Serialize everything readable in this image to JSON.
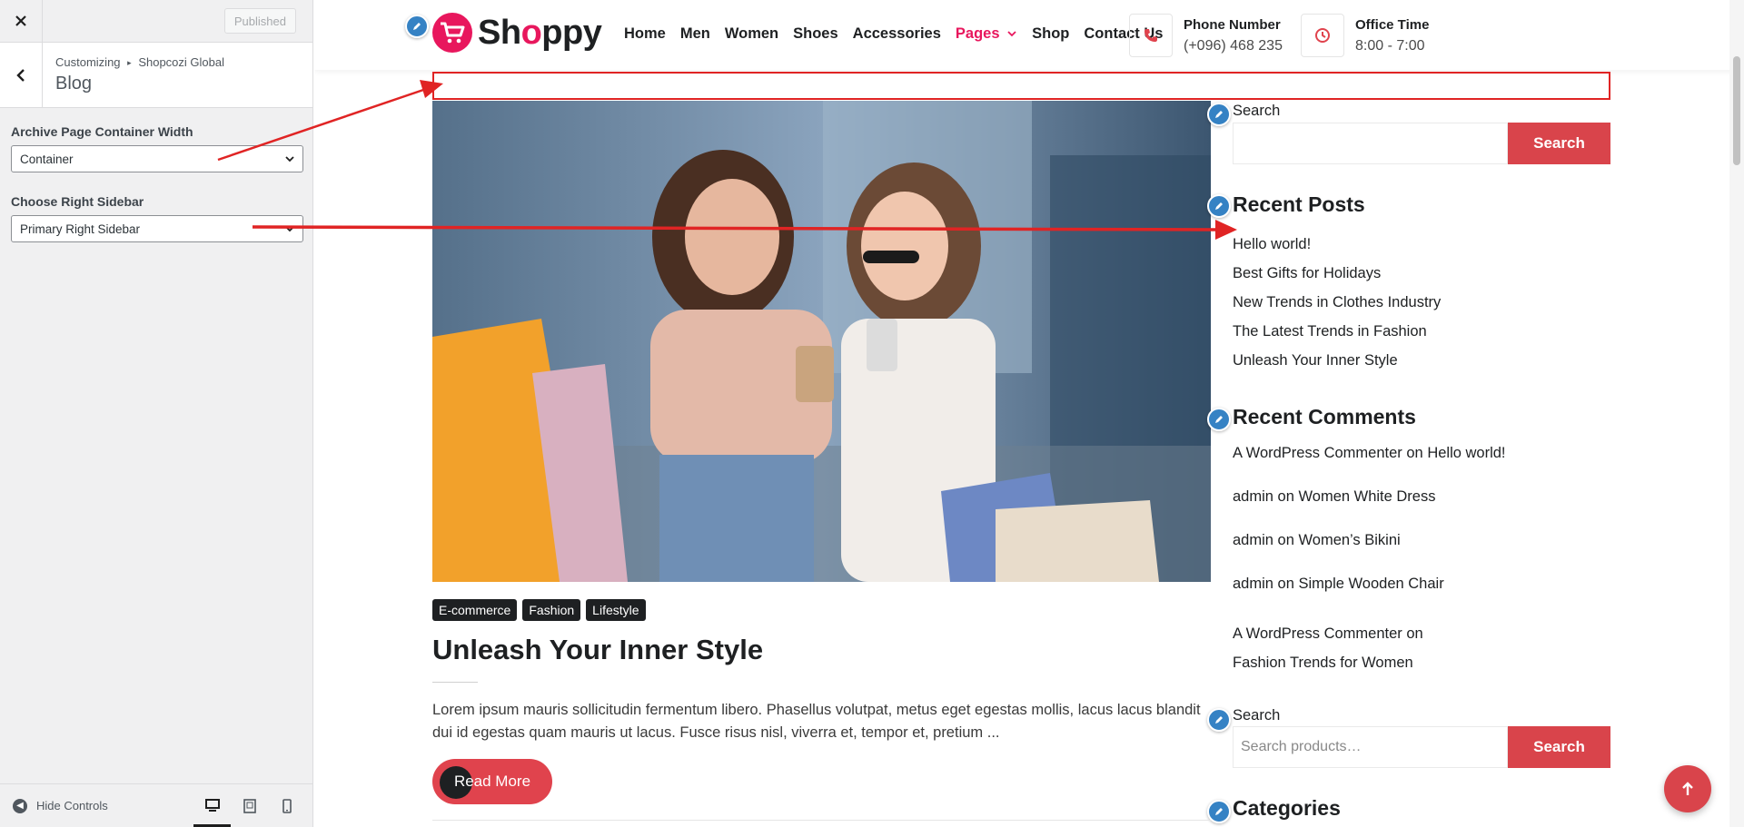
{
  "customizer": {
    "close_icon": "close-icon",
    "publish_label": "Published",
    "breadcrumb_root": "Customizing",
    "breadcrumb_separator": "▸",
    "breadcrumb_section": "Shopcozi Global",
    "section_title": "Blog",
    "controls": [
      {
        "label": "Archive Page Container Width",
        "value": "Container"
      },
      {
        "label": "Choose Right Sidebar",
        "value": "Primary Right Sidebar"
      }
    ],
    "hide_controls_label": "Hide Controls",
    "devices": [
      "desktop",
      "tablet",
      "mobile"
    ],
    "active_device": "desktop"
  },
  "site": {
    "logo_text_start": "Sh",
    "logo_text_o": "o",
    "logo_text_end": "ppy",
    "nav": [
      "Home",
      "Men",
      "Women",
      "Shoes",
      "Accessories",
      "Pages",
      "Shop",
      "Contact Us"
    ],
    "active_nav": "Pages",
    "phone_label": "Phone Number",
    "phone_value": "(+096) 468 235",
    "office_label": "Office Time",
    "office_value": "8:00 - 7:00",
    "accent_color": "#e8175d",
    "button_color": "#d9444b"
  },
  "post": {
    "tags": [
      "E-commerce",
      "Fashion",
      "Lifestyle"
    ],
    "title": "Unleash Your Inner Style",
    "excerpt": "Lorem ipsum mauris sollicitudin fermentum libero. Phasellus volutpat, metus eget egestas mollis, lacus lacus blandit dui id egestas quam mauris ut lacus. Fusce risus nisl, viverra et, tempor et, pretium ...",
    "read_more": "Read More"
  },
  "sidebar": {
    "search1_label": "Search",
    "search1_placeholder": "",
    "search1_button": "Search",
    "recent_posts_title": "Recent Posts",
    "recent_posts": [
      "Hello world!",
      "Best Gifts for Holidays",
      "New Trends in Clothes Industry",
      "The Latest Trends in Fashion",
      "Unleash Your Inner Style"
    ],
    "recent_comments_title": "Recent Comments",
    "recent_comments": [
      {
        "author": "A WordPress Commenter",
        "on": "on",
        "post": "Hello world!"
      },
      {
        "author": "admin",
        "on": "on",
        "post": "Women White Dress"
      },
      {
        "author": "admin",
        "on": "on",
        "post": "Women’s Bikini"
      },
      {
        "author": "admin",
        "on": "on",
        "post": "Simple Wooden Chair"
      },
      {
        "author": "A WordPress Commenter",
        "on": "on",
        "post": "Fashion Trends for Women"
      }
    ],
    "search2_label": "Search",
    "search2_placeholder": "Search products…",
    "search2_button": "Search",
    "categories_title": "Categories"
  }
}
